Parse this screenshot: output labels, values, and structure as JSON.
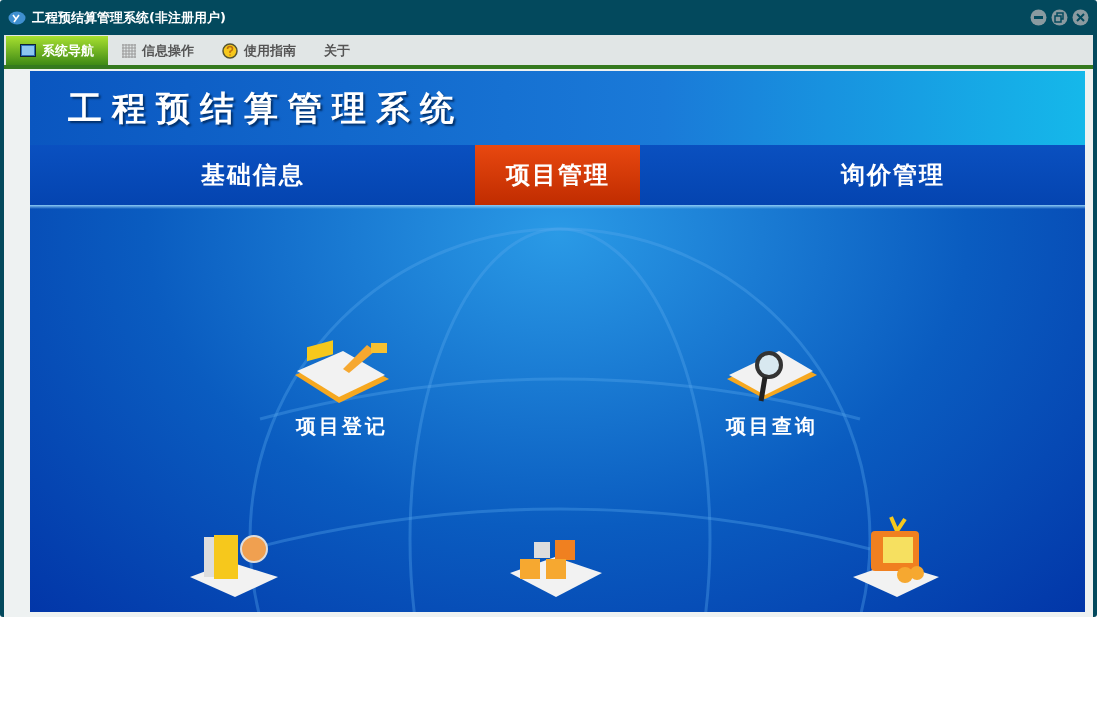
{
  "window": {
    "title": "工程预结算管理系统(非注册用户)"
  },
  "menu": [
    {
      "label": "系统导航",
      "selected": true
    },
    {
      "label": "信息操作",
      "selected": false
    },
    {
      "label": "使用指南",
      "selected": false
    },
    {
      "label": "关于",
      "selected": false
    }
  ],
  "banner": {
    "title": "工程预结算管理系统"
  },
  "nav_tabs": [
    {
      "label": "基础信息",
      "selected": false
    },
    {
      "label": "项目管理",
      "selected": true
    },
    {
      "label": "询价管理",
      "selected": false
    }
  ],
  "modules": [
    {
      "label": "项目登记",
      "kind": "register"
    },
    {
      "label": "项目查询",
      "kind": "search"
    }
  ]
}
